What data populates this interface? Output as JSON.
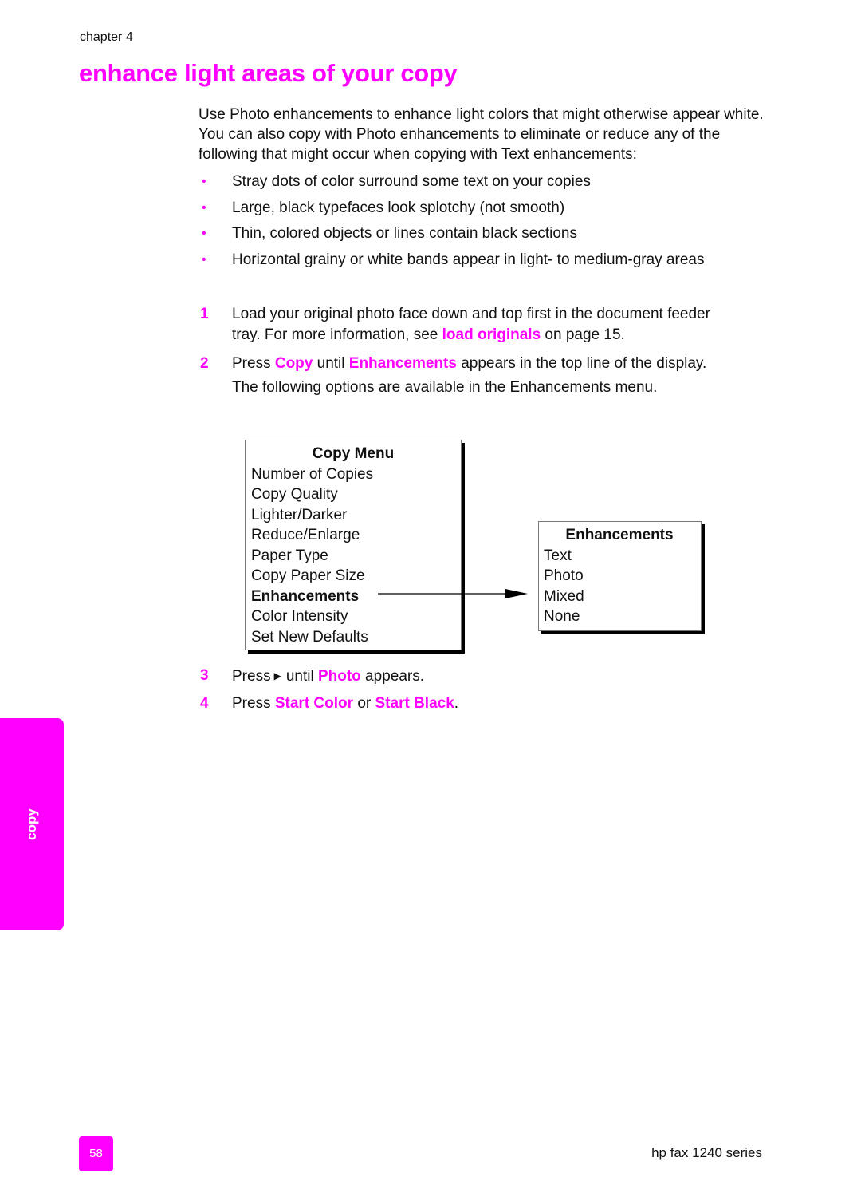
{
  "header": {
    "chapter": "chapter 4",
    "title": "enhance light areas of your copy"
  },
  "intro": "Use Photo enhancements to enhance light colors that might otherwise appear white. You can also copy with Photo enhancements to eliminate or reduce any of the following that might occur when copying with Text enhancements:",
  "bullets": [
    "Stray dots of color surround some text on your copies",
    "Large, black typefaces look splotchy (not smooth)",
    "Thin, colored objects or lines contain black sections",
    "Horizontal grainy or white bands appear in light- to medium-gray areas"
  ],
  "steps": [
    {
      "num": "1",
      "line1": "Load your original photo face down and top first in the document feeder",
      "line2_pre": "tray. For more information, see ",
      "link": "load originals",
      "line2_post": " on page 15."
    },
    {
      "num": "2",
      "pre": "Press ",
      "key1": "Copy",
      "mid": " until ",
      "key2": "Enhancements",
      "post": " appears in the top line of the display.",
      "line2": "The following options are available in the Enhancements menu."
    },
    {
      "num": "3",
      "pre": "Press",
      "icon": "right-arrow-icon",
      "mid": "until ",
      "key1": "Photo",
      "post": " appears."
    },
    {
      "num": "4",
      "pre": "Press ",
      "key1": "Start Color",
      "mid": " or ",
      "key2": "Start Black",
      "post": "."
    }
  ],
  "copy_menu": {
    "title": "Copy Menu",
    "items": [
      "Number of Copies",
      "Copy Quality",
      "Lighter/Darker",
      "Reduce/Enlarge",
      "Paper Type",
      "Copy Paper Size",
      "Enhancements",
      "Color Intensity",
      "Set New Defaults"
    ],
    "highlighted_index": 6
  },
  "enhancements_menu": {
    "title": "Enhancements",
    "items": [
      "Text",
      "Photo",
      "Mixed",
      "None"
    ]
  },
  "side_tab": {
    "label": "copy"
  },
  "footer": {
    "page_number": "58",
    "product": "hp fax 1240 series"
  },
  "colors": {
    "accent": "#ff00ff",
    "text": "#111111"
  }
}
